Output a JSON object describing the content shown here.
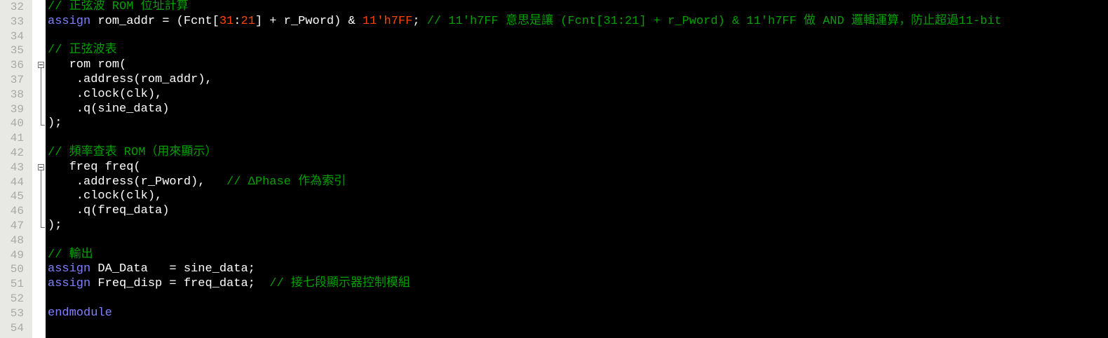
{
  "editor": {
    "lines": [
      {
        "num": "32",
        "segments": [
          {
            "t": "// 正弦波 ROM 位址計算",
            "c": "cm"
          }
        ]
      },
      {
        "num": "33",
        "segments": [
          {
            "t": "assign",
            "c": "kw"
          },
          {
            "t": " rom_addr = (Fcnt[",
            "c": "id"
          },
          {
            "t": "31",
            "c": "num"
          },
          {
            "t": ":",
            "c": "id"
          },
          {
            "t": "21",
            "c": "num"
          },
          {
            "t": "] + r_Pword) & ",
            "c": "id"
          },
          {
            "t": "11'h7FF",
            "c": "num"
          },
          {
            "t": "; ",
            "c": "id"
          },
          {
            "t": "// 11'h7FF 意思是讓 (Fcnt[31:21] + r_Pword) & 11'h7FF 做 AND 邏輯運算，防止超過11-bit",
            "c": "cm"
          }
        ]
      },
      {
        "num": "34",
        "segments": []
      },
      {
        "num": "35",
        "segments": [
          {
            "t": "// 正弦波表",
            "c": "cm"
          }
        ]
      },
      {
        "num": "36",
        "fold": "start",
        "segments": [
          {
            "t": "   rom rom(",
            "c": "id"
          }
        ]
      },
      {
        "num": "37",
        "segments": [
          {
            "t": "    .address(rom_addr),",
            "c": "id"
          }
        ]
      },
      {
        "num": "38",
        "segments": [
          {
            "t": "    .clock(clk),",
            "c": "id"
          }
        ]
      },
      {
        "num": "39",
        "segments": [
          {
            "t": "    .q(sine_data)",
            "c": "id"
          }
        ]
      },
      {
        "num": "40",
        "fold": "end",
        "segments": [
          {
            "t": ");",
            "c": "id"
          }
        ]
      },
      {
        "num": "41",
        "segments": []
      },
      {
        "num": "42",
        "segments": [
          {
            "t": "// 頻率查表 ROM（用來顯示）",
            "c": "cm"
          }
        ]
      },
      {
        "num": "43",
        "fold": "start",
        "segments": [
          {
            "t": "   freq freq(",
            "c": "id"
          }
        ]
      },
      {
        "num": "44",
        "segments": [
          {
            "t": "    .address(r_Pword),   ",
            "c": "id"
          },
          {
            "t": "// ΔPhase 作為索引",
            "c": "cm"
          }
        ]
      },
      {
        "num": "45",
        "segments": [
          {
            "t": "    .clock(clk),",
            "c": "id"
          }
        ]
      },
      {
        "num": "46",
        "segments": [
          {
            "t": "    .q(freq_data)",
            "c": "id"
          }
        ]
      },
      {
        "num": "47",
        "fold": "end",
        "segments": [
          {
            "t": ");",
            "c": "id"
          }
        ]
      },
      {
        "num": "48",
        "segments": []
      },
      {
        "num": "49",
        "segments": [
          {
            "t": "// 輸出",
            "c": "cm"
          }
        ]
      },
      {
        "num": "50",
        "segments": [
          {
            "t": "assign",
            "c": "kw"
          },
          {
            "t": " DA_Data   = sine_data;",
            "c": "id"
          }
        ]
      },
      {
        "num": "51",
        "segments": [
          {
            "t": "assign",
            "c": "kw"
          },
          {
            "t": " Freq_disp = freq_data;  ",
            "c": "id"
          },
          {
            "t": "// 接七段顯示器控制模組",
            "c": "cm"
          }
        ]
      },
      {
        "num": "52",
        "segments": []
      },
      {
        "num": "53",
        "segments": [
          {
            "t": "endmodule",
            "c": "kw"
          }
        ]
      },
      {
        "num": "54",
        "segments": []
      }
    ]
  },
  "colors": {
    "background": "#000000",
    "gutter": "#E8E8E4",
    "line_number": "#A8A8A8",
    "keyword": "#8080FF",
    "comment": "#00A000",
    "number": "#FF4500",
    "identifier": "#FFFFFF"
  }
}
